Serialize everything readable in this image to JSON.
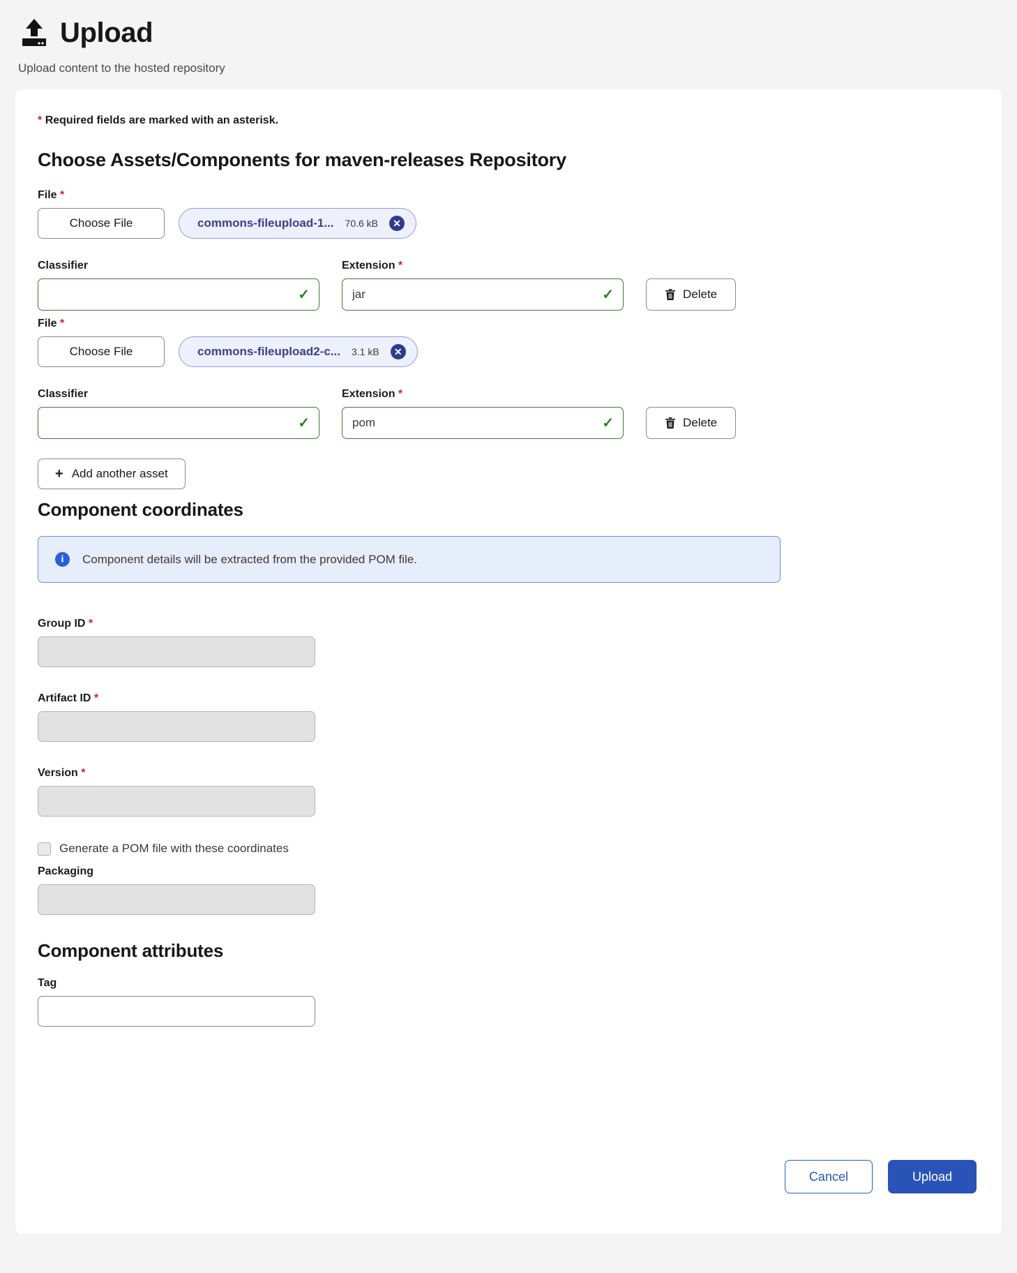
{
  "header": {
    "title": "Upload",
    "subtitle": "Upload content to the hosted repository",
    "icon": "upload-icon"
  },
  "form": {
    "required_note_star": "*",
    "required_note": "Required fields are marked with an asterisk.",
    "assets_heading": "Choose Assets/Components for maven-releases Repository",
    "choose_file_label": "Choose File",
    "file_label": "File",
    "classifier_label": "Classifier",
    "extension_label": "Extension",
    "delete_label": "Delete",
    "add_asset_label": "Add another asset",
    "asterisk": "*",
    "remove_chip_icon": "✕",
    "assets": [
      {
        "file_name": "commons-fileupload-1...",
        "file_size": "70.6 kB",
        "classifier_value": "",
        "extension_value": "jar"
      },
      {
        "file_name": "commons-fileupload2-c...",
        "file_size": "3.1 kB",
        "classifier_value": "",
        "extension_value": "pom"
      }
    ]
  },
  "coordinates": {
    "heading": "Component coordinates",
    "info_text": "Component details will be extracted from the provided POM file.",
    "info_icon": "info-icon",
    "group_id_label": "Group ID",
    "group_id_value": "",
    "artifact_id_label": "Artifact ID",
    "artifact_id_value": "",
    "version_label": "Version",
    "version_value": "",
    "generate_pom_label": "Generate a POM file with these coordinates",
    "generate_pom_checked": false,
    "packaging_label": "Packaging",
    "packaging_value": ""
  },
  "attributes": {
    "heading": "Component attributes",
    "tag_label": "Tag",
    "tag_value": ""
  },
  "actions": {
    "cancel_label": "Cancel",
    "upload_label": "Upload"
  },
  "colors": {
    "page_background": "#f4f4f4",
    "card_background": "#ffffff",
    "required_star": "#c02b2b",
    "chip_background": "#eef0fb",
    "chip_text": "#3b3f93",
    "valid_border": "#3d7a32",
    "valid_check": "#2e7d23",
    "info_background": "#e6edfb",
    "info_border": "#6f8fd8",
    "info_icon": "#2b5fd9",
    "primary_button": "#2a53b8",
    "cancel_text": "#2457c4",
    "disabled_field": "#e2e2e2"
  }
}
